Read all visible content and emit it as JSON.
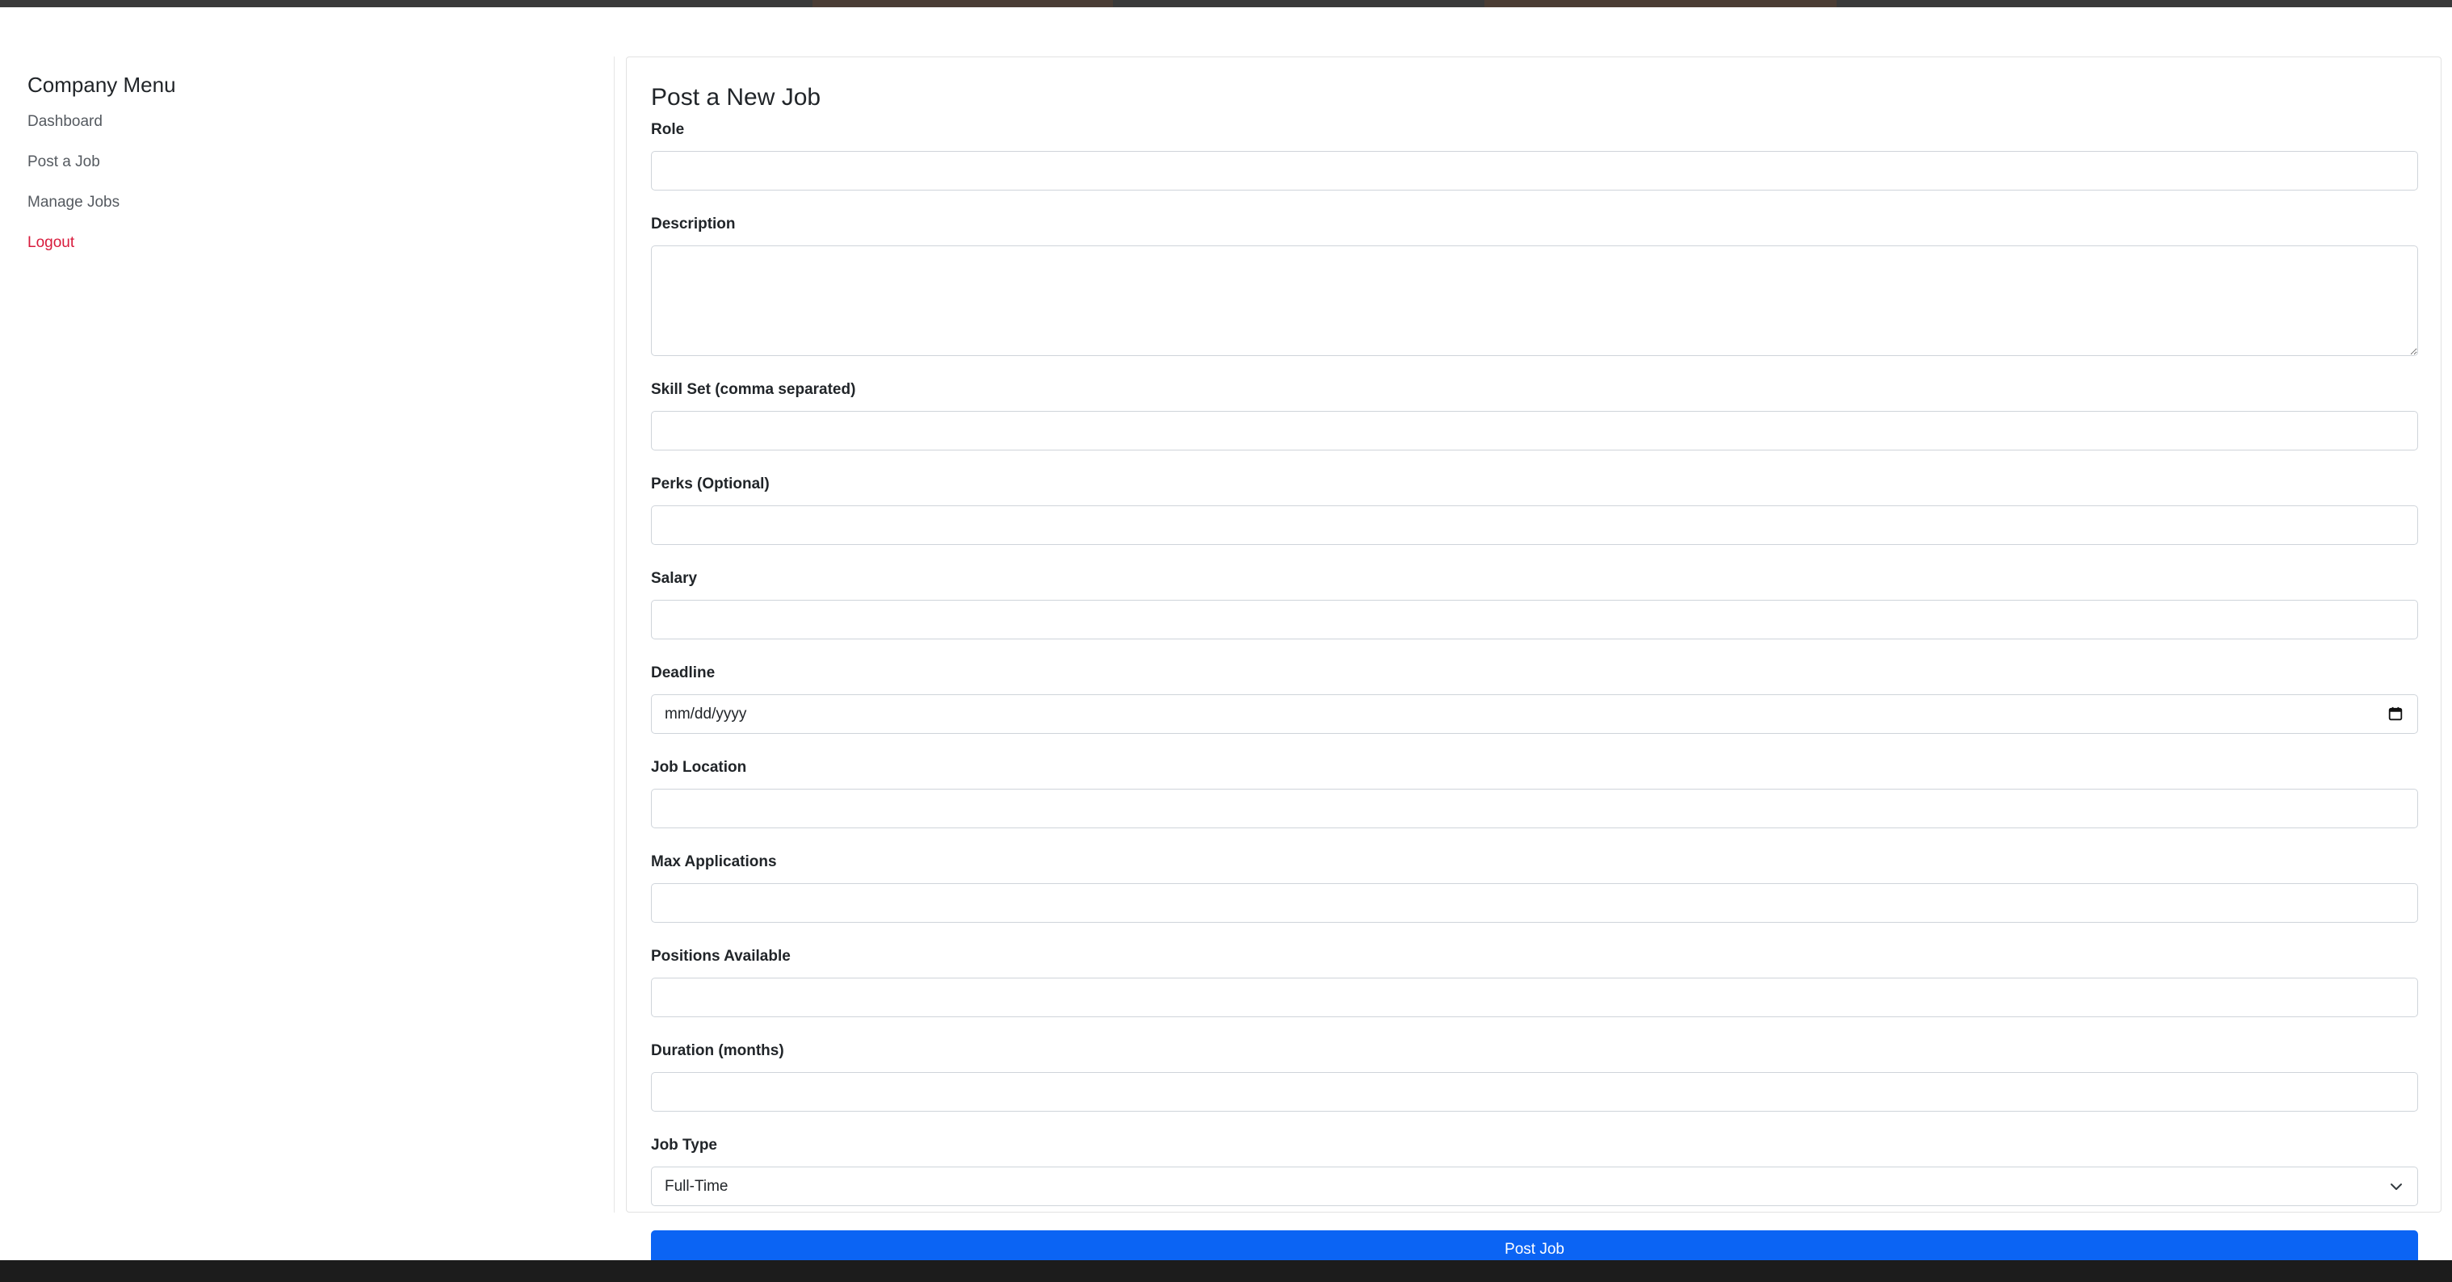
{
  "sidebar": {
    "title": "Company Menu",
    "items": [
      {
        "label": "Dashboard"
      },
      {
        "label": "Post a Job"
      },
      {
        "label": "Manage Jobs"
      },
      {
        "label": "Logout"
      }
    ]
  },
  "form": {
    "title": "Post a New Job",
    "fields": {
      "role": {
        "label": "Role",
        "value": ""
      },
      "description": {
        "label": "Description",
        "value": ""
      },
      "skills": {
        "label": "Skill Set (comma separated)",
        "value": ""
      },
      "perks": {
        "label": "Perks (Optional)",
        "value": ""
      },
      "salary": {
        "label": "Salary",
        "value": ""
      },
      "deadline": {
        "label": "Deadline",
        "placeholder": "mm/dd/yyyy"
      },
      "location": {
        "label": "Job Location",
        "value": ""
      },
      "max_applications": {
        "label": "Max Applications",
        "value": ""
      },
      "positions": {
        "label": "Positions Available",
        "value": ""
      },
      "duration": {
        "label": "Duration (months)",
        "value": ""
      },
      "job_type": {
        "label": "Job Type",
        "selected": "Full-Time"
      }
    },
    "submit_label": "Post Job"
  },
  "colors": {
    "primary": "#0b64f4",
    "logout": "#d81b3c",
    "footer": "#1c1c1c"
  },
  "icons": {
    "deadline": "calendar-icon",
    "job_type": "chevron-down-icon"
  }
}
